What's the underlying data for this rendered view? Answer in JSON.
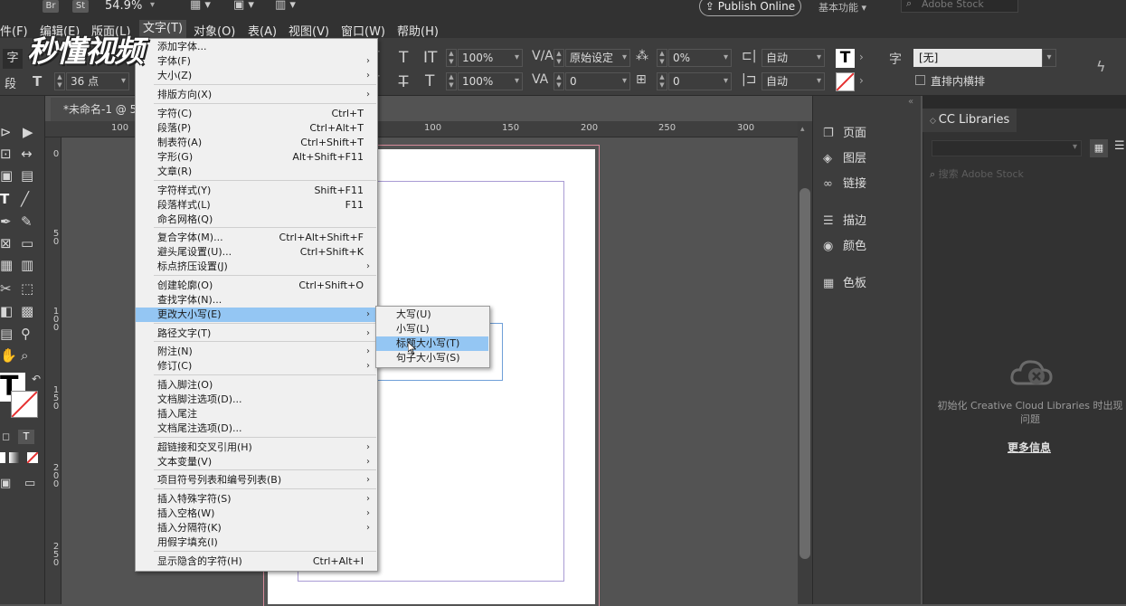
{
  "menubar": {
    "items": [
      "件(F)",
      "编辑(E)",
      "版面(L)",
      "文字(T)",
      "对象(O)",
      "表(A)",
      "视图(V)",
      "窗口(W)",
      "帮助(H)"
    ],
    "br_badge": "Br",
    "st_badge": "St",
    "zoom": "54.9%",
    "publish": "Publish Online",
    "workspace": "基本功能",
    "stock_placeholder": "Adobe Stock"
  },
  "watermark": "秒懂视频",
  "control": {
    "font_size": "36 点",
    "scale_v": "100%",
    "scale_h": "100%",
    "kerning": "原始设定",
    "tracking": "0",
    "baseline": "0%",
    "skew": "0",
    "auto1": "自动",
    "auto2": "自动",
    "zi": "字",
    "char_style": "[无]",
    "zhipai": "直排内横排",
    "duan": "段"
  },
  "doc": {
    "tab": "*未命名-1 @ 5",
    "ruler_h": [
      "100",
      "100",
      "150",
      "200",
      "250",
      "300"
    ],
    "ruler_v": [
      [
        "0"
      ],
      [
        "5",
        "0"
      ],
      [
        "1",
        "0",
        "0"
      ],
      [
        "1",
        "5",
        "0"
      ],
      [
        "2",
        "0",
        "0"
      ],
      [
        "2",
        "5",
        "0"
      ]
    ]
  },
  "panels": {
    "items": [
      "页面",
      "图层",
      "链接",
      "描边",
      "颜色",
      "色板"
    ],
    "cc_tab": "CC Libraries",
    "cc_search": "搜索 Adobe Stock",
    "cc_message": "初始化 Creative Cloud Libraries 时出现问题",
    "cc_more": "更多信息"
  },
  "menu": {
    "items": [
      {
        "label": "添加字体...",
        "shortcut": "",
        "arrow": false
      },
      {
        "label": "字体(F)",
        "shortcut": "",
        "arrow": true
      },
      {
        "label": "大小(Z)",
        "shortcut": "",
        "arrow": true
      },
      {
        "label": "排版方向(X)",
        "shortcut": "",
        "arrow": true
      },
      {
        "label": "字符(C)",
        "shortcut": "Ctrl+T",
        "arrow": false
      },
      {
        "label": "段落(P)",
        "shortcut": "Ctrl+Alt+T",
        "arrow": false
      },
      {
        "label": "制表符(A)",
        "shortcut": "Ctrl+Shift+T",
        "arrow": false
      },
      {
        "label": "字形(G)",
        "shortcut": "Alt+Shift+F11",
        "arrow": false
      },
      {
        "label": "文章(R)",
        "shortcut": "",
        "arrow": false
      },
      {
        "label": "字符样式(Y)",
        "shortcut": "Shift+F11",
        "arrow": false
      },
      {
        "label": "段落样式(L)",
        "shortcut": "F11",
        "arrow": false
      },
      {
        "label": "命名网格(Q)",
        "shortcut": "",
        "arrow": false
      },
      {
        "label": "复合字体(M)...",
        "shortcut": "Ctrl+Alt+Shift+F",
        "arrow": false
      },
      {
        "label": "避头尾设置(U)...",
        "shortcut": "Ctrl+Shift+K",
        "arrow": false
      },
      {
        "label": "标点挤压设置(J)",
        "shortcut": "",
        "arrow": true
      },
      {
        "label": "创建轮廓(O)",
        "shortcut": "Ctrl+Shift+O",
        "arrow": false
      },
      {
        "label": "查找字体(N)...",
        "shortcut": "",
        "arrow": false
      },
      {
        "label": "更改大小写(E)",
        "shortcut": "",
        "arrow": true
      },
      {
        "label": "路径文字(T)",
        "shortcut": "",
        "arrow": true
      },
      {
        "label": "附注(N)",
        "shortcut": "",
        "arrow": true
      },
      {
        "label": "修订(C)",
        "shortcut": "",
        "arrow": true
      },
      {
        "label": "插入脚注(O)",
        "shortcut": "",
        "arrow": false
      },
      {
        "label": "文档脚注选项(D)...",
        "shortcut": "",
        "arrow": false
      },
      {
        "label": "插入尾注",
        "shortcut": "",
        "arrow": false
      },
      {
        "label": "文档尾注选项(D)...",
        "shortcut": "",
        "arrow": false
      },
      {
        "label": "超链接和交叉引用(H)",
        "shortcut": "",
        "arrow": true
      },
      {
        "label": "文本变量(V)",
        "shortcut": "",
        "arrow": true
      },
      {
        "label": "项目符号列表和编号列表(B)",
        "shortcut": "",
        "arrow": true
      },
      {
        "label": "插入特殊字符(S)",
        "shortcut": "",
        "arrow": true
      },
      {
        "label": "插入空格(W)",
        "shortcut": "",
        "arrow": true
      },
      {
        "label": "插入分隔符(K)",
        "shortcut": "",
        "arrow": true
      },
      {
        "label": "用假字填充(I)",
        "shortcut": "",
        "arrow": false
      },
      {
        "label": "显示隐含的字符(H)",
        "shortcut": "Ctrl+Alt+I",
        "arrow": false
      }
    ],
    "highlighted_index": 17
  },
  "submenu": {
    "items": [
      "大写(U)",
      "小写(L)",
      "标题大小写(T)",
      "句子大小写(S)"
    ],
    "highlighted_index": 2
  },
  "colors": {
    "highlight": "#94c6f3",
    "menu_bg": "#f0f0f0",
    "ui_dark": "#323232"
  }
}
